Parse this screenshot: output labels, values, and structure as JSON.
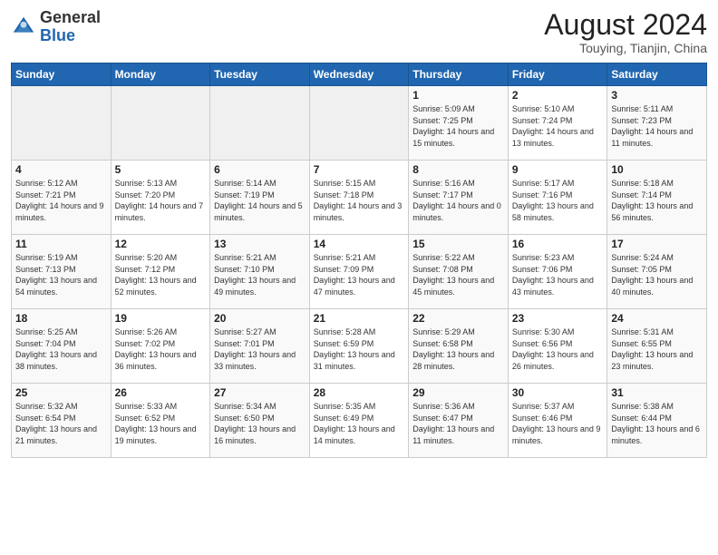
{
  "header": {
    "logo_general": "General",
    "logo_blue": "Blue",
    "month_title": "August 2024",
    "location": "Touying, Tianjin, China"
  },
  "weekdays": [
    "Sunday",
    "Monday",
    "Tuesday",
    "Wednesday",
    "Thursday",
    "Friday",
    "Saturday"
  ],
  "weeks": [
    [
      {
        "day": "",
        "empty": true
      },
      {
        "day": "",
        "empty": true
      },
      {
        "day": "",
        "empty": true
      },
      {
        "day": "",
        "empty": true
      },
      {
        "day": "1",
        "sunrise": "5:09 AM",
        "sunset": "7:25 PM",
        "daylight": "14 hours and 15 minutes."
      },
      {
        "day": "2",
        "sunrise": "5:10 AM",
        "sunset": "7:24 PM",
        "daylight": "14 hours and 13 minutes."
      },
      {
        "day": "3",
        "sunrise": "5:11 AM",
        "sunset": "7:23 PM",
        "daylight": "14 hours and 11 minutes."
      }
    ],
    [
      {
        "day": "4",
        "sunrise": "5:12 AM",
        "sunset": "7:21 PM",
        "daylight": "14 hours and 9 minutes."
      },
      {
        "day": "5",
        "sunrise": "5:13 AM",
        "sunset": "7:20 PM",
        "daylight": "14 hours and 7 minutes."
      },
      {
        "day": "6",
        "sunrise": "5:14 AM",
        "sunset": "7:19 PM",
        "daylight": "14 hours and 5 minutes."
      },
      {
        "day": "7",
        "sunrise": "5:15 AM",
        "sunset": "7:18 PM",
        "daylight": "14 hours and 3 minutes."
      },
      {
        "day": "8",
        "sunrise": "5:16 AM",
        "sunset": "7:17 PM",
        "daylight": "14 hours and 0 minutes."
      },
      {
        "day": "9",
        "sunrise": "5:17 AM",
        "sunset": "7:16 PM",
        "daylight": "13 hours and 58 minutes."
      },
      {
        "day": "10",
        "sunrise": "5:18 AM",
        "sunset": "7:14 PM",
        "daylight": "13 hours and 56 minutes."
      }
    ],
    [
      {
        "day": "11",
        "sunrise": "5:19 AM",
        "sunset": "7:13 PM",
        "daylight": "13 hours and 54 minutes."
      },
      {
        "day": "12",
        "sunrise": "5:20 AM",
        "sunset": "7:12 PM",
        "daylight": "13 hours and 52 minutes."
      },
      {
        "day": "13",
        "sunrise": "5:21 AM",
        "sunset": "7:10 PM",
        "daylight": "13 hours and 49 minutes."
      },
      {
        "day": "14",
        "sunrise": "5:21 AM",
        "sunset": "7:09 PM",
        "daylight": "13 hours and 47 minutes."
      },
      {
        "day": "15",
        "sunrise": "5:22 AM",
        "sunset": "7:08 PM",
        "daylight": "13 hours and 45 minutes."
      },
      {
        "day": "16",
        "sunrise": "5:23 AM",
        "sunset": "7:06 PM",
        "daylight": "13 hours and 43 minutes."
      },
      {
        "day": "17",
        "sunrise": "5:24 AM",
        "sunset": "7:05 PM",
        "daylight": "13 hours and 40 minutes."
      }
    ],
    [
      {
        "day": "18",
        "sunrise": "5:25 AM",
        "sunset": "7:04 PM",
        "daylight": "13 hours and 38 minutes."
      },
      {
        "day": "19",
        "sunrise": "5:26 AM",
        "sunset": "7:02 PM",
        "daylight": "13 hours and 36 minutes."
      },
      {
        "day": "20",
        "sunrise": "5:27 AM",
        "sunset": "7:01 PM",
        "daylight": "13 hours and 33 minutes."
      },
      {
        "day": "21",
        "sunrise": "5:28 AM",
        "sunset": "6:59 PM",
        "daylight": "13 hours and 31 minutes."
      },
      {
        "day": "22",
        "sunrise": "5:29 AM",
        "sunset": "6:58 PM",
        "daylight": "13 hours and 28 minutes."
      },
      {
        "day": "23",
        "sunrise": "5:30 AM",
        "sunset": "6:56 PM",
        "daylight": "13 hours and 26 minutes."
      },
      {
        "day": "24",
        "sunrise": "5:31 AM",
        "sunset": "6:55 PM",
        "daylight": "13 hours and 23 minutes."
      }
    ],
    [
      {
        "day": "25",
        "sunrise": "5:32 AM",
        "sunset": "6:54 PM",
        "daylight": "13 hours and 21 minutes."
      },
      {
        "day": "26",
        "sunrise": "5:33 AM",
        "sunset": "6:52 PM",
        "daylight": "13 hours and 19 minutes."
      },
      {
        "day": "27",
        "sunrise": "5:34 AM",
        "sunset": "6:50 PM",
        "daylight": "13 hours and 16 minutes."
      },
      {
        "day": "28",
        "sunrise": "5:35 AM",
        "sunset": "6:49 PM",
        "daylight": "13 hours and 14 minutes."
      },
      {
        "day": "29",
        "sunrise": "5:36 AM",
        "sunset": "6:47 PM",
        "daylight": "13 hours and 11 minutes."
      },
      {
        "day": "30",
        "sunrise": "5:37 AM",
        "sunset": "6:46 PM",
        "daylight": "13 hours and 9 minutes."
      },
      {
        "day": "31",
        "sunrise": "5:38 AM",
        "sunset": "6:44 PM",
        "daylight": "13 hours and 6 minutes."
      }
    ]
  ]
}
